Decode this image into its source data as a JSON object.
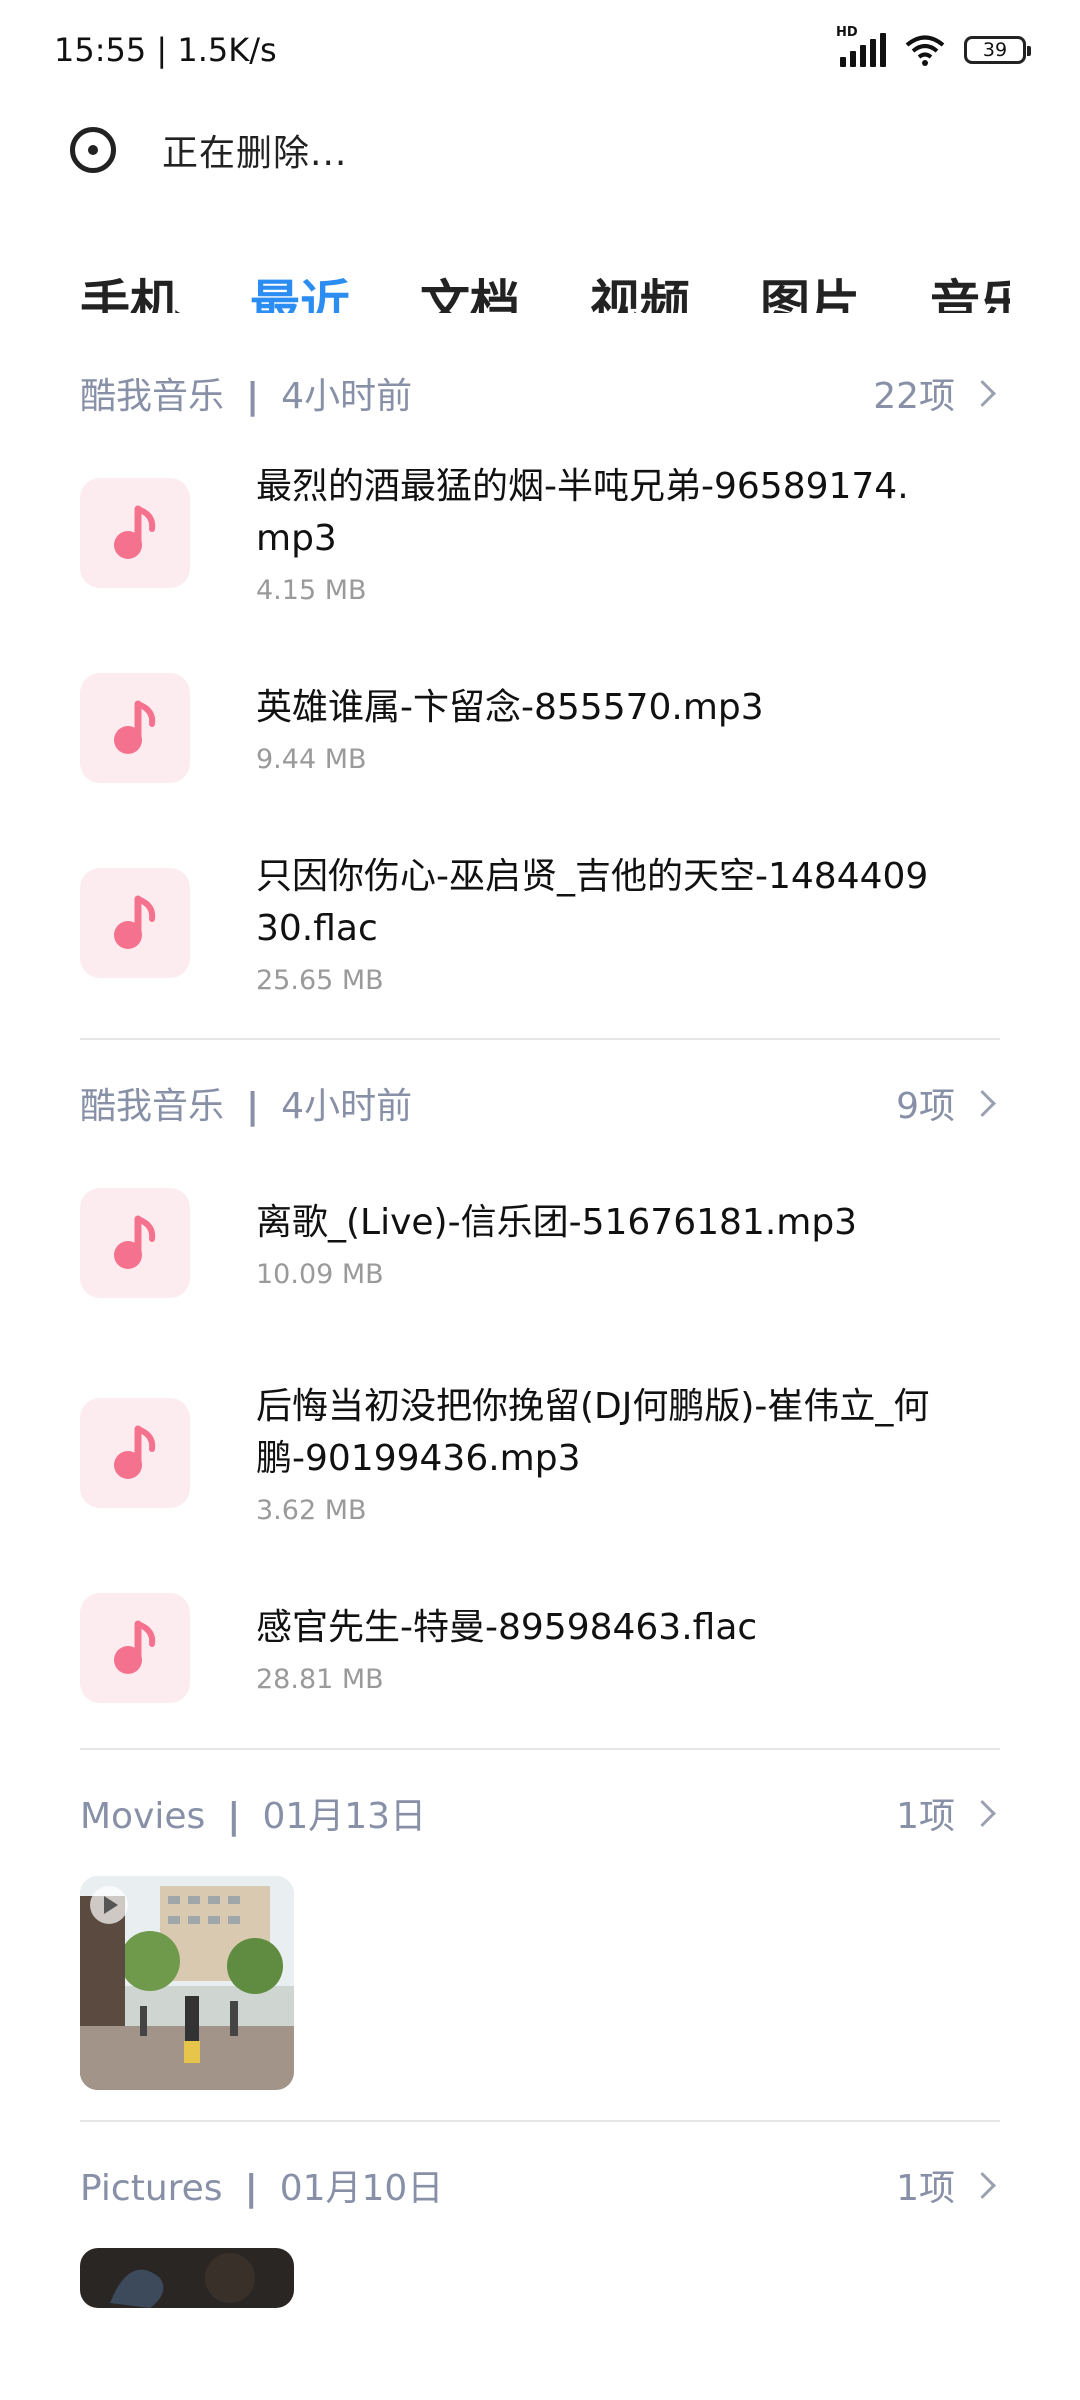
{
  "status_bar": {
    "time_speed": "15:55 | 1.5K/s",
    "hd_label": "HD",
    "battery": "39"
  },
  "header": {
    "deleting_text": "正在删除..."
  },
  "tabs": [
    "手机",
    "最近",
    "文档",
    "视频",
    "图片",
    "音乐"
  ],
  "groups": [
    {
      "source": "酷我音乐",
      "time": "4小时前",
      "count": "22项",
      "files": [
        {
          "name": "最烈的酒最猛的烟-半吨兄弟-96589174.mp3",
          "size": "4.15 MB"
        },
        {
          "name": "英雄谁属-卞留念-855570.mp3",
          "size": "9.44 MB"
        },
        {
          "name": "只因你伤心-巫启贤_吉他的天空-148440930.flac",
          "size": "25.65 MB"
        }
      ]
    },
    {
      "source": "酷我音乐",
      "time": "4小时前",
      "count": "9项",
      "files": [
        {
          "name": "离歌_(Live)-信乐团-51676181.mp3",
          "size": "10.09 MB"
        },
        {
          "name": "后悔当初没把你挽留(DJ何鹏版)-崔伟立_何鹏-90199436.mp3",
          "size": "3.62 MB"
        },
        {
          "name": "感官先生-特曼-89598463.flac",
          "size": "28.81 MB"
        }
      ]
    },
    {
      "source": "Movies",
      "time": "01月13日",
      "count": "1项"
    },
    {
      "source": "Pictures",
      "time": "01月10日",
      "count": "1项"
    }
  ],
  "colors": {
    "accent": "#2b8df2",
    "music_icon": "#f4728e",
    "music_icon_bg": "#fdecef",
    "group_header": "#8790a6"
  }
}
